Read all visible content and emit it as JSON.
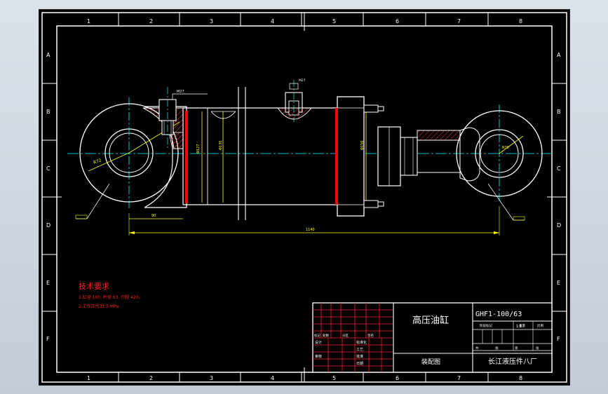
{
  "drawing": {
    "column_markers": [
      "1",
      "2",
      "3",
      "4",
      "5",
      "6",
      "7",
      "8"
    ],
    "row_markers": [
      "A",
      "B",
      "C",
      "D",
      "E",
      "F"
    ],
    "tech_requirements": {
      "heading": "技术要求",
      "line1": "1.缸径 100, 杆径 63, 行程 420。",
      "line2": "2.工作压力31.5 MPa"
    },
    "title_block": {
      "product_name": "高压油缸",
      "drawing_number": "GHF1-100/63",
      "drawing_type": "装配图",
      "company": "长江液压件八厂",
      "labels": [
        "标记",
        "处数",
        "分区",
        "设计",
        "工艺",
        "审核",
        "批准",
        "阶段标记",
        "重量",
        "比例",
        "共",
        "张",
        "第",
        "张",
        "标准化",
        "日期",
        "签名"
      ],
      "scale": "1:1"
    },
    "dimensions": {
      "total_length": "1140",
      "left_offset": "90",
      "bore": "Φ127",
      "body_dia": "Φ130",
      "flange_dia": "Φ150",
      "port_size": "M27",
      "left_eye_radius": "R72",
      "right_eye_radius": "R70"
    }
  },
  "colors": {
    "frame": "#ffffff",
    "outline": "#ffffff",
    "dimension": "#ffff00",
    "centerline": "#00ffff",
    "hatch": "#ff3333",
    "seal": "#ff0000",
    "text_red": "#ff2020",
    "block_grid": "#ff2020",
    "block_text": "#ffffff"
  }
}
